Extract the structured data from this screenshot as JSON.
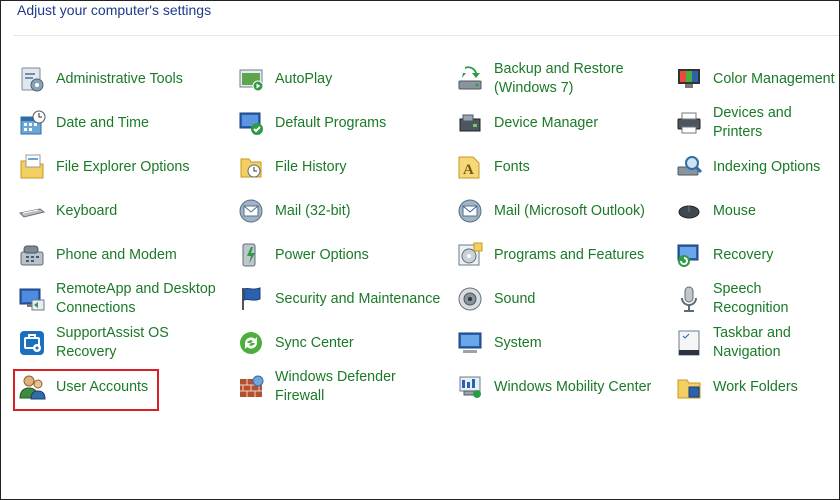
{
  "header": {
    "title": "Adjust your computer's settings"
  },
  "colors": {
    "link": "#1a7a27",
    "title": "#1e3a8a",
    "highlight": "#d81f26"
  },
  "columns": [
    [
      {
        "label": "Administrative Tools",
        "icon": "administrative-tools-icon"
      },
      {
        "label": "Date and Time",
        "icon": "date-and-time-icon"
      },
      {
        "label": "File Explorer Options",
        "icon": "file-explorer-options-icon"
      },
      {
        "label": "Keyboard",
        "icon": "keyboard-icon"
      },
      {
        "label": "Phone and Modem",
        "icon": "phone-and-modem-icon"
      },
      {
        "label": "RemoteApp and Desktop\nConnections",
        "icon": "remoteapp-icon"
      },
      {
        "label": "SupportAssist OS\nRecovery",
        "icon": "supportassist-icon"
      },
      {
        "label": "User Accounts",
        "icon": "user-accounts-icon"
      }
    ],
    [
      {
        "label": "AutoPlay",
        "icon": "autoplay-icon"
      },
      {
        "label": "Default Programs",
        "icon": "default-programs-icon"
      },
      {
        "label": "File History",
        "icon": "file-history-icon"
      },
      {
        "label": "Mail (32-bit)",
        "icon": "mail-icon"
      },
      {
        "label": "Power Options",
        "icon": "power-options-icon"
      },
      {
        "label": "Security and Maintenance",
        "icon": "security-flag-icon"
      },
      {
        "label": "Sync Center",
        "icon": "sync-center-icon"
      },
      {
        "label": "Windows Defender\nFirewall",
        "icon": "firewall-icon"
      }
    ],
    [
      {
        "label": "Backup and Restore\n(Windows 7)",
        "icon": "backup-restore-icon"
      },
      {
        "label": "Device Manager",
        "icon": "device-manager-icon"
      },
      {
        "label": "Fonts",
        "icon": "fonts-icon"
      },
      {
        "label": "Mail (Microsoft Outlook)",
        "icon": "mail-outlook-icon"
      },
      {
        "label": "Programs and Features",
        "icon": "programs-features-icon"
      },
      {
        "label": "Sound",
        "icon": "sound-icon"
      },
      {
        "label": "System",
        "icon": "system-icon"
      },
      {
        "label": "Windows Mobility Center",
        "icon": "mobility-center-icon"
      }
    ],
    [
      {
        "label": "Color Management",
        "icon": "color-management-icon"
      },
      {
        "label": "Devices and Printers",
        "icon": "devices-printers-icon"
      },
      {
        "label": "Indexing Options",
        "icon": "indexing-options-icon"
      },
      {
        "label": "Mouse",
        "icon": "mouse-icon"
      },
      {
        "label": "Recovery",
        "icon": "recovery-icon"
      },
      {
        "label": "Speech Recognition",
        "icon": "speech-recognition-icon"
      },
      {
        "label": "Taskbar and Navigation",
        "icon": "taskbar-navigation-icon"
      },
      {
        "label": "Work Folders",
        "icon": "work-folders-icon"
      }
    ]
  ]
}
